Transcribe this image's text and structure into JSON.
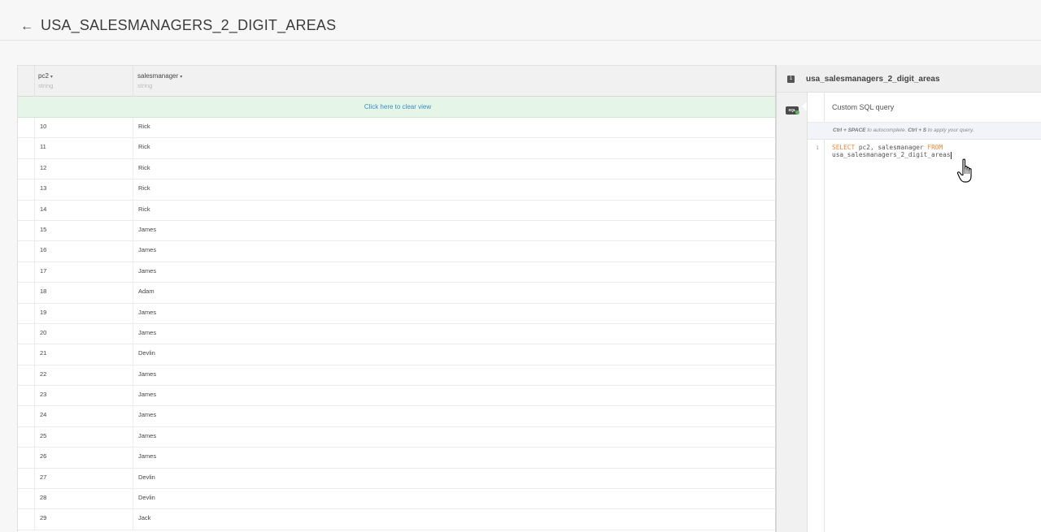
{
  "header": {
    "title": "USA_SALESMANAGERS_2_DIGIT_AREAS",
    "back_icon": "arrow-left-icon"
  },
  "table": {
    "columns": [
      {
        "name": "pc2",
        "type": "string"
      },
      {
        "name": "salesmanager",
        "type": "string"
      }
    ],
    "clear_view_label": "Click here to clear view",
    "rows": [
      [
        "10",
        "Rick"
      ],
      [
        "11",
        "Rick"
      ],
      [
        "12",
        "Rick"
      ],
      [
        "13",
        "Rick"
      ],
      [
        "14",
        "Rick"
      ],
      [
        "15",
        "James"
      ],
      [
        "16",
        "James"
      ],
      [
        "17",
        "James"
      ],
      [
        "18",
        "Adam"
      ],
      [
        "19",
        "James"
      ],
      [
        "20",
        "James"
      ],
      [
        "21",
        "Devlin"
      ],
      [
        "22",
        "James"
      ],
      [
        "23",
        "James"
      ],
      [
        "24",
        "James"
      ],
      [
        "25",
        "James"
      ],
      [
        "26",
        "James"
      ],
      [
        "27",
        "Devlin"
      ],
      [
        "28",
        "Devlin"
      ],
      [
        "29",
        "Jack"
      ]
    ]
  },
  "recipe": {
    "step_number": "1",
    "name": "usa_salesmanagers_2_digit_areas",
    "step_icon_label": "SQL",
    "editor": {
      "title": "Custom SQL query",
      "hint_key1": "Ctrl + SPACE",
      "hint_text1": " to autocomplete. ",
      "hint_key2": "Ctrl + S",
      "hint_text2": " to apply your query.",
      "line_number": "1",
      "kw_select": "SELECT",
      "cols": " pc2, salesmanager ",
      "kw_from": "FROM",
      "table_name": "usa_salesmanagers_2_digit_areas"
    }
  },
  "colors": {
    "accent_link": "#3a8ec2",
    "clear_bar_bg": "#e5f5e8",
    "keyword": "#f0883e",
    "status_dot": "#5cb85c"
  }
}
